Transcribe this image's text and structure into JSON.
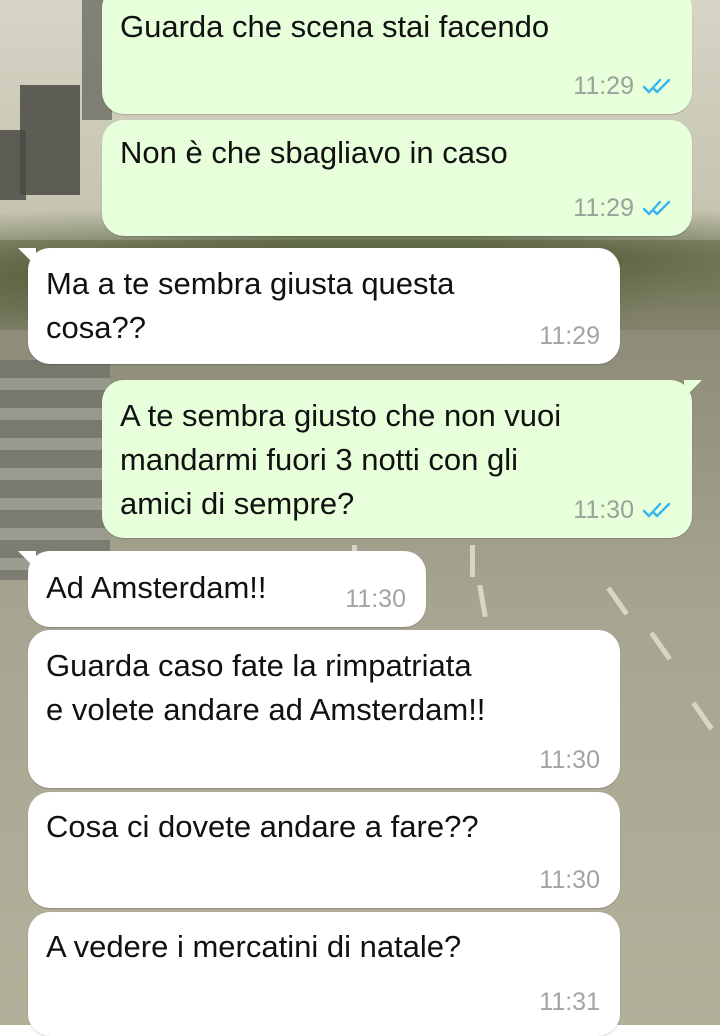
{
  "messages": [
    {
      "direction": "out",
      "text": "Guarda che scena stai facendo",
      "time": "11:29",
      "status": "read-double-check-icon"
    },
    {
      "direction": "out",
      "text": "Non è che sbagliavo in caso",
      "time": "11:29",
      "status": "read-double-check-icon"
    },
    {
      "direction": "in",
      "text": "Ma a te sembra giusta questa\ncosa??",
      "time": "11:29"
    },
    {
      "direction": "out",
      "text": "A te sembra giusto che non vuoi\nmandarmi fuori 3 notti con gli\namici di sempre?",
      "time": "11:30",
      "status": "read-double-check-icon"
    },
    {
      "direction": "in",
      "text": "Ad Amsterdam!!",
      "time": "11:30"
    },
    {
      "direction": "in",
      "text": "Guarda caso fate la rimpatriata\ne volete andare ad Amsterdam!!",
      "time": "11:30"
    },
    {
      "direction": "in",
      "text": "Cosa ci dovete andare a fare??",
      "time": "11:30"
    },
    {
      "direction": "in",
      "text": "A vedere i mercatini di natale?",
      "time": "11:31"
    }
  ],
  "colors": {
    "outgoing_bubble": "#e7ffdb",
    "incoming_bubble": "#ffffff",
    "read_check": "#34b7f1",
    "timestamp": "#9aa39a"
  }
}
